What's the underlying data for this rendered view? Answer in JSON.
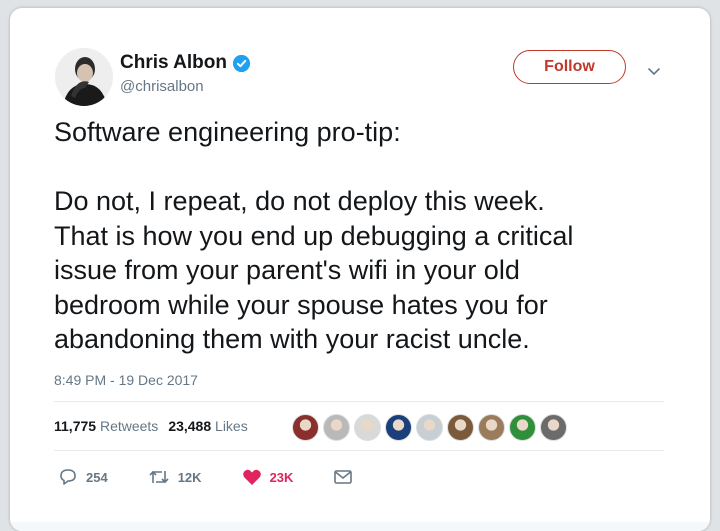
{
  "author": {
    "name": "Chris Albon",
    "handle": "@chrisalbon",
    "verified": true,
    "verified_color": "#1da1f2"
  },
  "follow_button": {
    "label": "Follow",
    "color": "#c0392b"
  },
  "tweet": {
    "lines": [
      "Software engineering pro-tip:",
      "",
      "Do not, I repeat, do not deploy this week.",
      "That is how you end up debugging a critical",
      "issue from your parent's wifi in your old",
      "bedroom while your spouse hates you for",
      "abandoning them with your racist uncle."
    ]
  },
  "timestamp": "8:49 PM - 19 Dec 2017",
  "stats": {
    "retweets_count": "11,775",
    "retweets_label": "Retweets",
    "likes_count": "23,488",
    "likes_label": "Likes"
  },
  "liker_faces": [
    "#8b2e2e",
    "#b9b9b9",
    "#d9d9d9",
    "#1b3f7a",
    "#c7ced4",
    "#7a5a3a",
    "#9a7b5c",
    "#2f8f3a",
    "#6b6b6b"
  ],
  "actions": {
    "reply_count": "254",
    "retweet_count": "12K",
    "like_count": "23K",
    "like_color": "#e0245e"
  }
}
